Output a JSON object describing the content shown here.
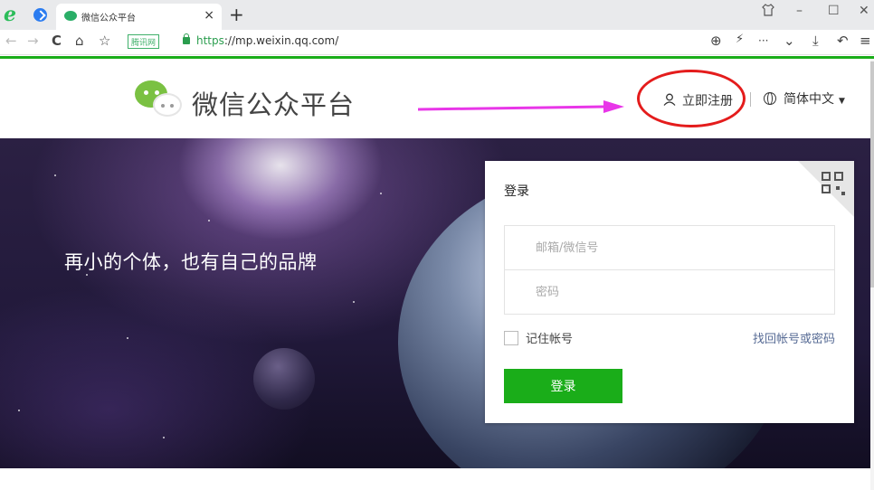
{
  "browser": {
    "tab_title": "微信公众平台",
    "tab_close": "×",
    "new_tab": "+",
    "address": {
      "site_badge": "腾讯网",
      "url_scheme": "https",
      "url_rest": "://mp.weixin.qq.com/"
    },
    "window_controls": {
      "minimize": "–",
      "maximize": "☐",
      "close": "✕"
    },
    "nav": {
      "back": "←",
      "forward": "→",
      "reload": "C",
      "home": "⌂",
      "favorite": "☆",
      "zoom": "⊕",
      "flash": "⚡",
      "more": "···",
      "dropdown": "⌄",
      "download": "⤓",
      "undo": "↶",
      "menu": "≡"
    },
    "accent_color": "#1aad19"
  },
  "header": {
    "brand": "微信公众平台",
    "register_label": "立即注册",
    "language_label": "简体中文"
  },
  "banner": {
    "slogan": "再小的个体，也有自己的品牌"
  },
  "login": {
    "heading": "登录",
    "account_placeholder": "邮箱/微信号",
    "password_placeholder": "密码",
    "remember_label": "记住帐号",
    "forgot_link": "找回帐号或密码",
    "submit_label": "登录",
    "button_color": "#1aad19",
    "link_color": "#576b95"
  },
  "annotation": {
    "circle_color": "#e41c1c",
    "arrow_color": "#e836e8"
  }
}
